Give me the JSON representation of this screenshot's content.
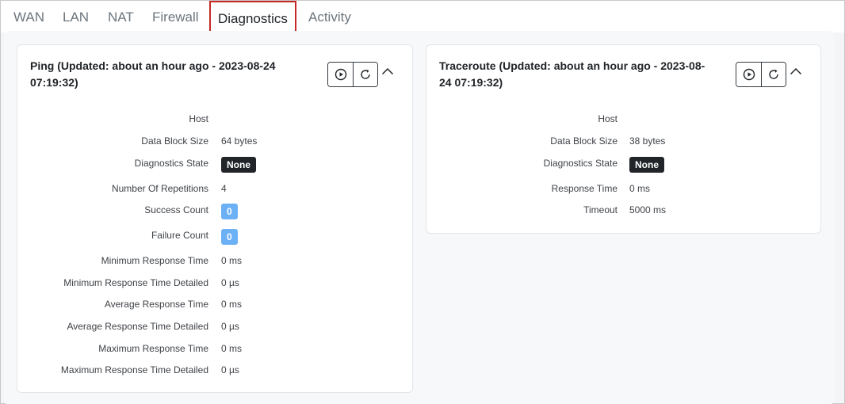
{
  "tabs": [
    {
      "label": "WAN"
    },
    {
      "label": "LAN"
    },
    {
      "label": "NAT"
    },
    {
      "label": "Firewall"
    },
    {
      "label": "Diagnostics",
      "active": true
    },
    {
      "label": "Activity"
    }
  ],
  "ping": {
    "title_line1": "Ping (Updated: about an hour ago - 2023-08-24",
    "title_line2": "07:19:32)",
    "rows": [
      {
        "label": "Host",
        "value": ""
      },
      {
        "label": "Data Block Size",
        "value": "64 bytes"
      },
      {
        "label": "Diagnostics State",
        "value": "None"
      },
      {
        "label": "Number Of Repetitions",
        "value": "4"
      },
      {
        "label": "Success Count",
        "value": "0"
      },
      {
        "label": "Failure Count",
        "value": "0"
      },
      {
        "label": "Minimum Response Time",
        "value": "0 ms"
      },
      {
        "label": "Minimum Response Time Detailed",
        "value": "0 µs"
      },
      {
        "label": "Average Response Time",
        "value": "0 ms"
      },
      {
        "label": "Average Response Time Detailed",
        "value": "0 µs"
      },
      {
        "label": "Maximum Response Time",
        "value": "0 ms"
      },
      {
        "label": "Maximum Response Time Detailed",
        "value": "0 µs"
      }
    ]
  },
  "traceroute": {
    "title_line1": "Traceroute (Updated: about an hour ago - 2023-08-",
    "title_line2": "24 07:19:32)",
    "rows": [
      {
        "label": "Host",
        "value": ""
      },
      {
        "label": "Data Block Size",
        "value": "38 bytes"
      },
      {
        "label": "Diagnostics State",
        "value": "None"
      },
      {
        "label": "Response Time",
        "value": "0 ms"
      },
      {
        "label": "Timeout",
        "value": "5000 ms"
      }
    ]
  },
  "icons": {
    "run": "play-circle-icon",
    "refresh": "refresh-icon",
    "collapse": "chevron-up-icon"
  },
  "colors": {
    "active_tab_border": "#c62828",
    "badge_dark": "#212529",
    "badge_blue": "#6cb1f5"
  }
}
